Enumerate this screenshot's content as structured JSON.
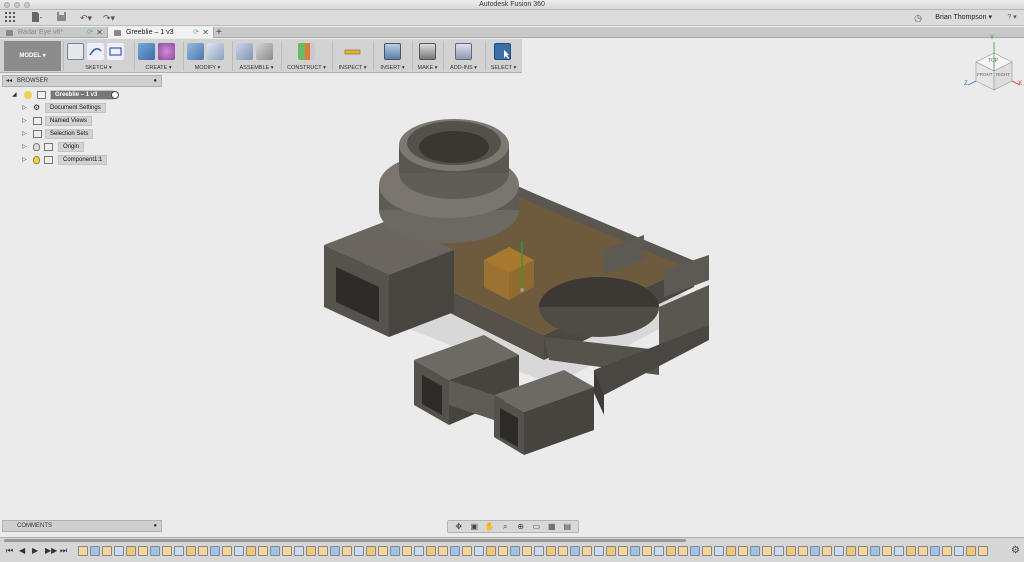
{
  "window": {
    "title": "Autodesk Fusion 360"
  },
  "user": {
    "name": "Brian Thompson ▾",
    "help": "? ▾"
  },
  "tabs": [
    {
      "label": "Radar Eye v6*",
      "active": false
    },
    {
      "label": "Greeblie – 1 v3",
      "active": true
    }
  ],
  "ribbon": {
    "workspace": "MODEL ▾",
    "groups": [
      {
        "label": "SKETCH ▾"
      },
      {
        "label": "CREATE ▾"
      },
      {
        "label": "MODIFY ▾"
      },
      {
        "label": "ASSEMBLE ▾"
      },
      {
        "label": "CONSTRUCT ▾"
      },
      {
        "label": "INSPECT ▾"
      },
      {
        "label": "INSERT ▾"
      },
      {
        "label": "MAKE ▾"
      },
      {
        "label": "ADD-INS ▾"
      },
      {
        "label": "SELECT ▾"
      }
    ]
  },
  "browser": {
    "title": "BROWSER",
    "root": "Greeblie – 1 v3",
    "items": [
      "Document Settings",
      "Named Views",
      "Selection Sets",
      "Origin",
      "Component1:1"
    ]
  },
  "comments": {
    "title": "COMMENTS"
  },
  "viewcube": {
    "top": "TOP",
    "front": "FRONT",
    "right": "RIGHT",
    "axis_x": "X",
    "axis_y": "Y",
    "axis_z": "Z"
  },
  "colors": {
    "accent": "#3a6fa8",
    "model_body": "#6b6862",
    "model_brown": "#6e5a3c",
    "selection": "#f0a020"
  }
}
